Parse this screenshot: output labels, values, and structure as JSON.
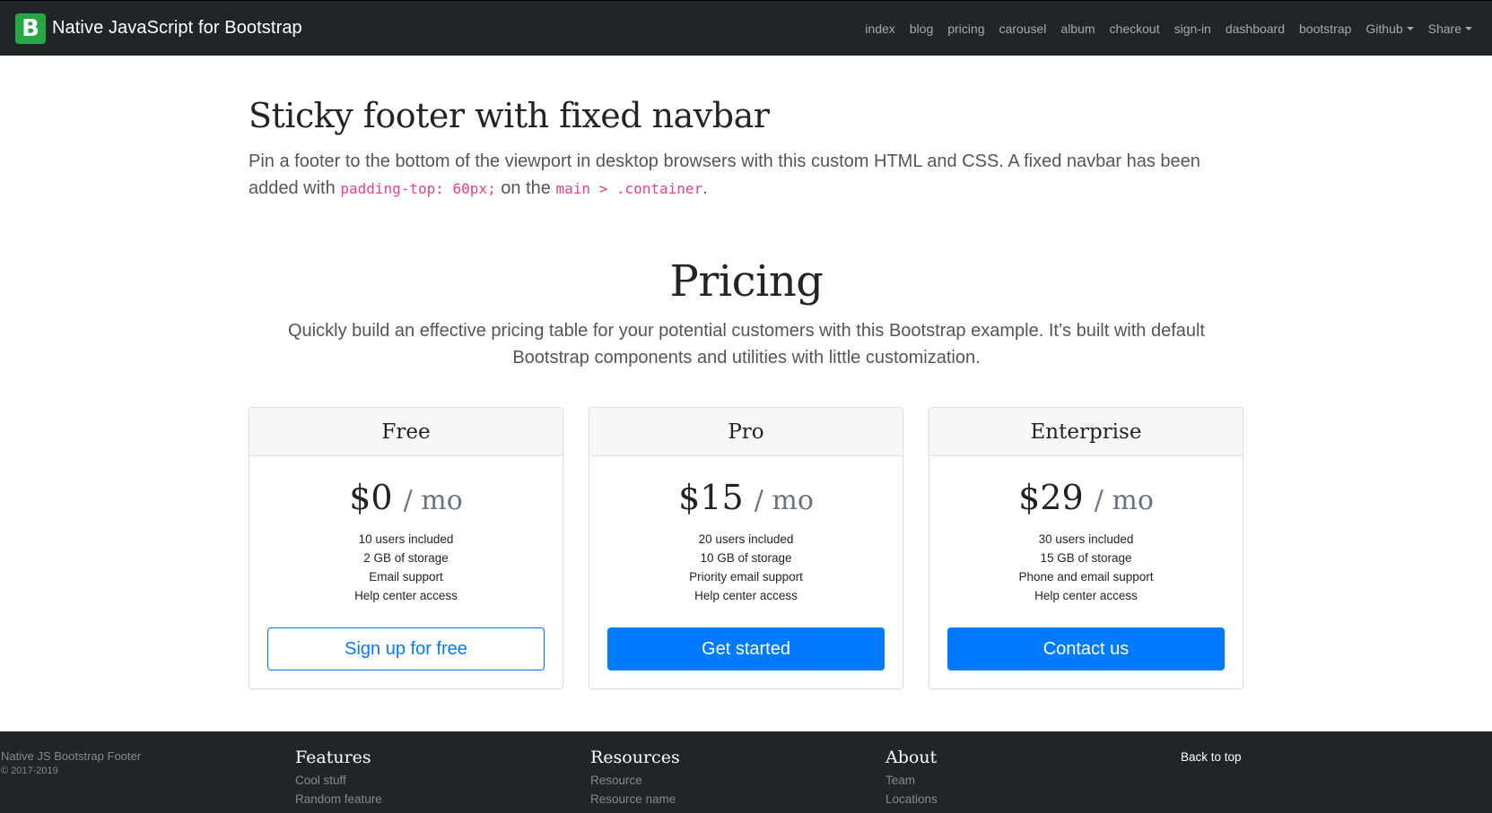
{
  "navbar": {
    "logo_letter": "B",
    "brand": "Native JavaScript for Bootstrap",
    "links": [
      "index",
      "blog",
      "pricing",
      "carousel",
      "album",
      "checkout",
      "sign-in",
      "dashboard",
      "bootstrap",
      "Github",
      "Share"
    ]
  },
  "lead": {
    "title": "Sticky footer with fixed navbar",
    "text_before": "Pin a footer to the bottom of the viewport in desktop browsers with this custom HTML and CSS. A fixed navbar has been added with",
    "code1": "padding-top: 60px;",
    "text_middle": "on the",
    "code2": "main > .container",
    "text_end": "."
  },
  "pricing": {
    "title": "Pricing",
    "description": "Quickly build an effective pricing table for your potential customers with this Bootstrap example. It’s built with default Bootstrap components and utilities with little customization.",
    "per": "/ mo",
    "plans": [
      {
        "name": "Free",
        "price": "$0",
        "features": [
          "10 users included",
          "2 GB of storage",
          "Email support",
          "Help center access"
        ],
        "button": "Sign up for free"
      },
      {
        "name": "Pro",
        "price": "$15",
        "features": [
          "20 users included",
          "10 GB of storage",
          "Priority email support",
          "Help center access"
        ],
        "button": "Get started"
      },
      {
        "name": "Enterprise",
        "price": "$29",
        "features": [
          "30 users included",
          "15 GB of storage",
          "Phone and email support",
          "Help center access"
        ],
        "button": "Contact us"
      }
    ]
  },
  "footer": {
    "brand_title": "Native JS Bootstrap Footer",
    "copyright": "© 2017-2019",
    "columns": [
      {
        "title": "Features",
        "links": [
          "Cool stuff",
          "Random feature"
        ]
      },
      {
        "title": "Resources",
        "links": [
          "Resource",
          "Resource name"
        ]
      },
      {
        "title": "About",
        "links": [
          "Team",
          "Locations"
        ]
      }
    ],
    "back_to_top": "Back to top"
  },
  "colors": {
    "navbar_bg": "#212529",
    "brand_green": "#28a745",
    "primary": "#007bff",
    "code_pink": "#e83e8c"
  }
}
